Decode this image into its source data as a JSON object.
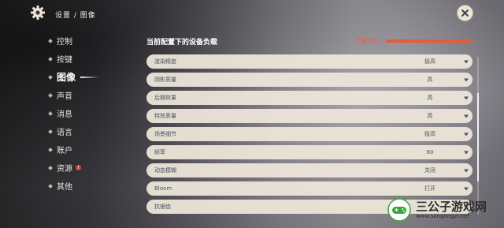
{
  "header": {
    "breadcrumb": "设置 / 图像",
    "icon": "gear-icon",
    "close_icon": "close-icon"
  },
  "sidebar": {
    "items": [
      {
        "label": "控制",
        "active": false,
        "badge": false
      },
      {
        "label": "按键",
        "active": false,
        "badge": false
      },
      {
        "label": "图像",
        "active": true,
        "badge": false
      },
      {
        "label": "声音",
        "active": false,
        "badge": false
      },
      {
        "label": "消息",
        "active": false,
        "badge": false
      },
      {
        "label": "语言",
        "active": false,
        "badge": false
      },
      {
        "label": "账户",
        "active": false,
        "badge": false
      },
      {
        "label": "资源",
        "active": false,
        "badge": true
      },
      {
        "label": "其他",
        "active": false,
        "badge": false
      }
    ],
    "badge_text": "!"
  },
  "device_load": {
    "title": "当前配置下的设备负载",
    "status": "严重过高",
    "level": 1.0,
    "color": "#e95a3c"
  },
  "settings": [
    {
      "label": "渲染精度",
      "value": "极高"
    },
    {
      "label": "阴影质量",
      "value": "高"
    },
    {
      "label": "后期效果",
      "value": "高"
    },
    {
      "label": "特效质量",
      "value": "高"
    },
    {
      "label": "场景细节",
      "value": "极高"
    },
    {
      "label": "帧率",
      "value": "60"
    },
    {
      "label": "动态模糊",
      "value": "关闭"
    },
    {
      "label": "Bloom",
      "value": "打开"
    },
    {
      "label": "抗锯齿",
      "value": ""
    }
  ],
  "watermark": {
    "name": "三公子游戏网",
    "url": "www.sangongzi.net"
  }
}
